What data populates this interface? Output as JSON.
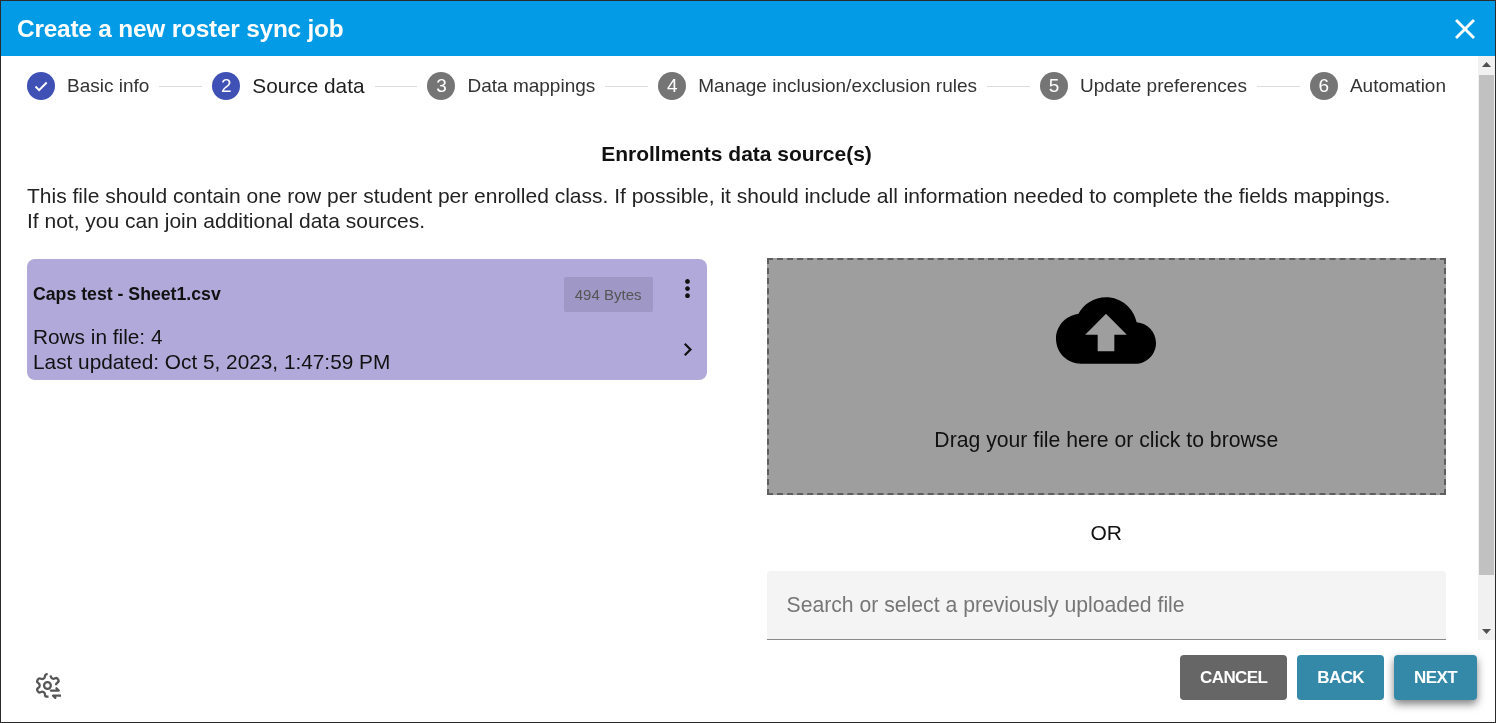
{
  "dialog": {
    "title": "Create a new roster sync job"
  },
  "steps": [
    {
      "label": "Basic info",
      "completed": true,
      "selected": false
    },
    {
      "number": "2",
      "label": "Source data",
      "completed": false,
      "selected": true
    },
    {
      "number": "3",
      "label": "Data mappings",
      "completed": false,
      "selected": false
    },
    {
      "number": "4",
      "label": "Manage inclusion/exclusion rules",
      "completed": false,
      "selected": false
    },
    {
      "number": "5",
      "label": "Update preferences",
      "completed": false,
      "selected": false
    },
    {
      "number": "6",
      "label": "Automation",
      "completed": false,
      "selected": false
    }
  ],
  "section": {
    "heading": "Enrollments data source(s)",
    "description": "This file should contain one row per student per enrolled class. If possible, it should include all information needed to complete the fields mappings. If not, you can join additional data sources."
  },
  "files": [
    {
      "name": "Caps test - Sheet1.csv",
      "size": "494 Bytes",
      "rows": "Rows in file: 4",
      "updated": "Last updated: Oct 5, 2023, 1:47:59 PM"
    }
  ],
  "dropzone": {
    "text": "Drag your file here or click to browse"
  },
  "separator": "OR",
  "search": {
    "placeholder": "Search or select a previously uploaded file"
  },
  "buttons": [
    {
      "label": "CANCEL",
      "kind": "neutral",
      "focused": false
    },
    {
      "label": "BACK",
      "kind": "primary",
      "focused": false
    },
    {
      "label": "NEXT",
      "kind": "primary",
      "focused": true
    }
  ]
}
